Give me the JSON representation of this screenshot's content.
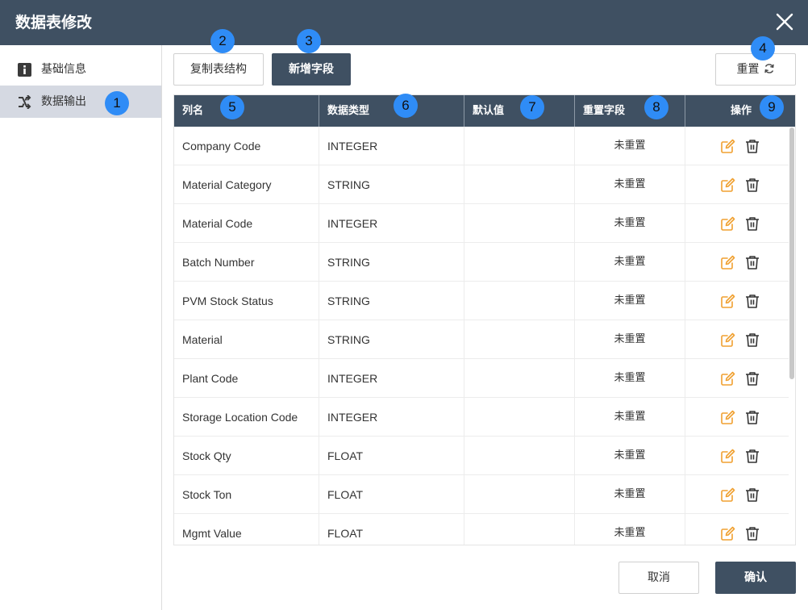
{
  "dialog": {
    "title": "数据表修改"
  },
  "sidebar": {
    "items": [
      {
        "label": "基础信息",
        "icon": "info-icon",
        "active": false
      },
      {
        "label": "数据输出",
        "icon": "shuffle-icon",
        "active": true
      }
    ]
  },
  "toolbar": {
    "copy_label": "复制表结构",
    "add_field_label": "新增字段",
    "reset_label": "重置"
  },
  "table": {
    "headers": [
      "列名",
      "数据类型",
      "默认值",
      "重置字段",
      "操作"
    ],
    "rows": [
      {
        "name": "Company Code",
        "type": "INTEGER",
        "default": "",
        "reset": "未重置"
      },
      {
        "name": "Material Category",
        "type": "STRING",
        "default": "",
        "reset": "未重置"
      },
      {
        "name": "Material Code",
        "type": "INTEGER",
        "default": "",
        "reset": "未重置"
      },
      {
        "name": "Batch Number",
        "type": "STRING",
        "default": "",
        "reset": "未重置"
      },
      {
        "name": "PVM Stock Status",
        "type": "STRING",
        "default": "",
        "reset": "未重置"
      },
      {
        "name": "Material",
        "type": "STRING",
        "default": "",
        "reset": "未重置"
      },
      {
        "name": "Plant Code",
        "type": "INTEGER",
        "default": "",
        "reset": "未重置"
      },
      {
        "name": "Storage Location Code",
        "type": "INTEGER",
        "default": "",
        "reset": "未重置"
      },
      {
        "name": "Stock Qty",
        "type": "FLOAT",
        "default": "",
        "reset": "未重置"
      },
      {
        "name": "Stock Ton",
        "type": "FLOAT",
        "default": "",
        "reset": "未重置"
      },
      {
        "name": "Mgmt Value",
        "type": "FLOAT",
        "default": "",
        "reset": "未重置"
      }
    ]
  },
  "footer": {
    "cancel_label": "取消",
    "confirm_label": "确认"
  },
  "badges": [
    "1",
    "2",
    "3",
    "4",
    "5",
    "6",
    "7",
    "8",
    "9"
  ],
  "colors": {
    "header": "#3f5062",
    "active_nav": "#d5d9e2",
    "badge": "#2f8cf6",
    "edit_icon": "#f0a030"
  }
}
